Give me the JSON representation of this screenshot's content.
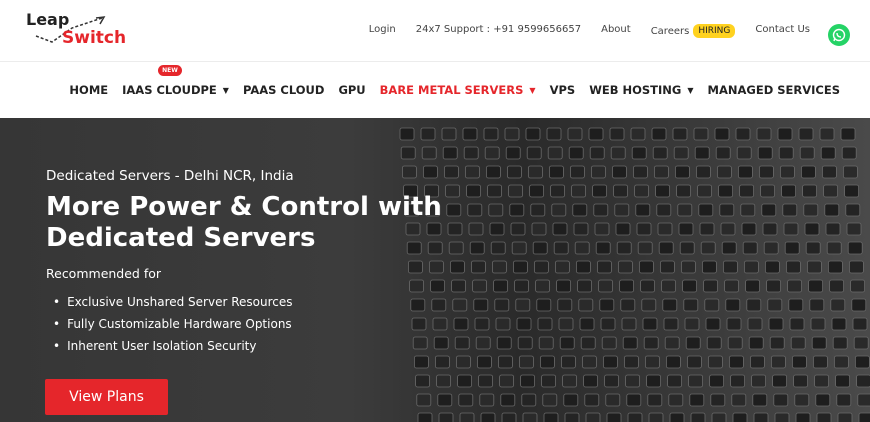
{
  "brand": {
    "logo_top": "Leap",
    "logo_bottom": "Switch",
    "accent": "#e5262b"
  },
  "top_links": [
    {
      "label": "Login"
    },
    {
      "label": "24x7 Support : +91 9599656657"
    },
    {
      "label": "About"
    },
    {
      "label": "Careers",
      "badge": "HIRING"
    },
    {
      "label": "Contact Us"
    }
  ],
  "whatsapp": {
    "icon": "whatsapp-icon"
  },
  "nav": {
    "new_badge": "NEW",
    "items": [
      {
        "label": "HOME"
      },
      {
        "label": "IAAS CLOUDPE"
      },
      {
        "label": "PAAS CLOUD"
      },
      {
        "label": "GPU"
      },
      {
        "label": "BARE METAL SERVERS"
      },
      {
        "label": "VPS"
      },
      {
        "label": "WEB HOSTING"
      },
      {
        "label": "MANAGED SERVICES"
      }
    ]
  },
  "hero": {
    "subtitle": "Dedicated Servers - Delhi NCR, India",
    "title": "More Power & Control with Dedicated Servers",
    "recommended": "Recommended for",
    "points": [
      "Exclusive Unshared Server Resources",
      "Fully Customizable Hardware Options",
      "Inherent User Isolation Security"
    ],
    "cta": "View Plans"
  }
}
